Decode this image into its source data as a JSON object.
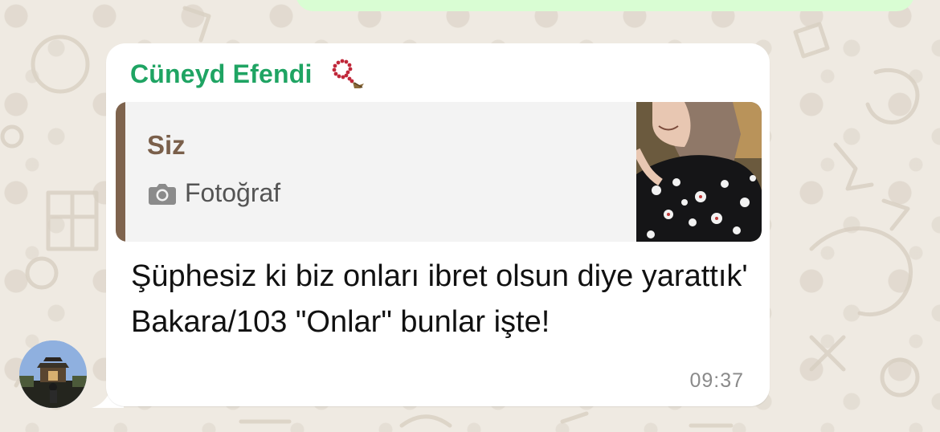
{
  "chat": {
    "message": {
      "sender": "Cüneyd Efendi",
      "sender_emoji_icon": "prayer-beads-icon",
      "quoted": {
        "author": "Siz",
        "media_label": "Fotoğraf",
        "media_icon": "camera-icon"
      },
      "text": "Şüphesiz ki biz onları ibret olsun diye yarattık' Bakara/103 \"Onlar\" bunlar işte!",
      "time": "09:37"
    }
  },
  "colors": {
    "sender_name": "#1fa463",
    "quote_bar": "#7e634d",
    "bubble": "#ffffff",
    "outgoing_bubble": "#d9fdd3",
    "wallpaper": "#efeae2"
  }
}
